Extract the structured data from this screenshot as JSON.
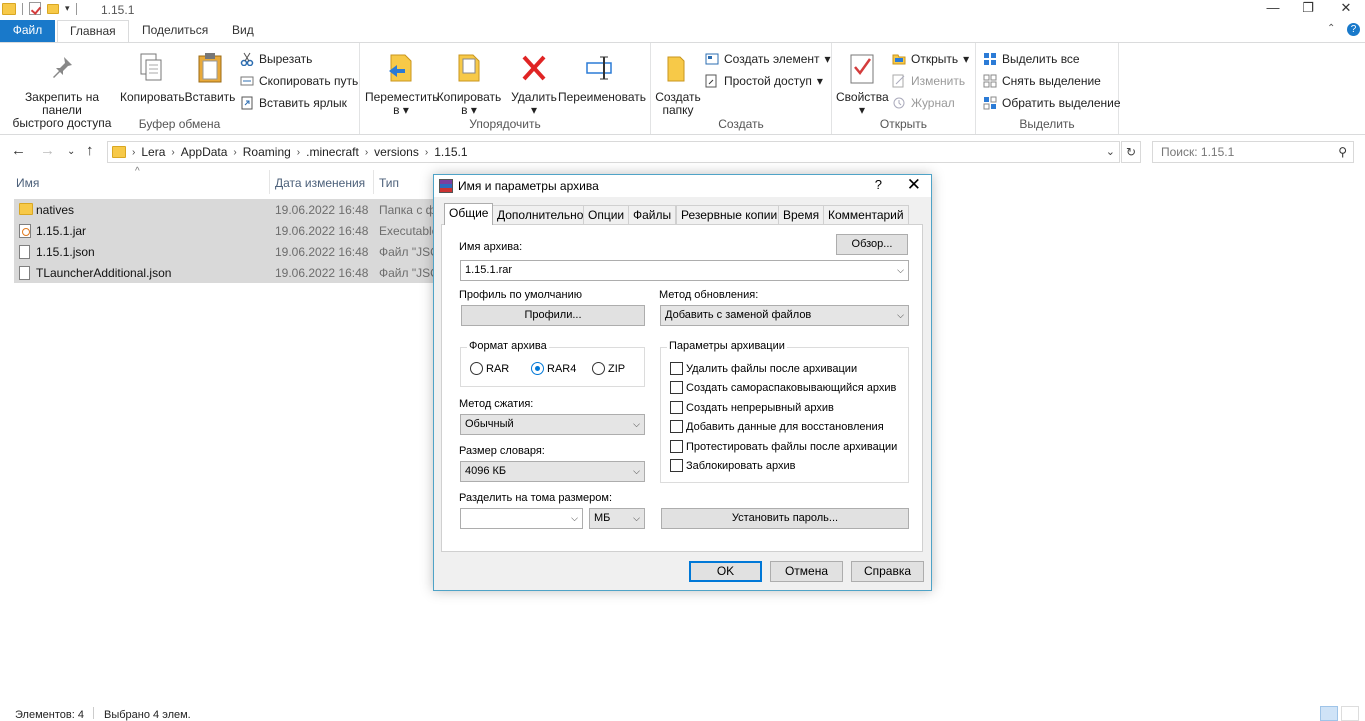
{
  "window": {
    "title": "1.15.1",
    "controls": [
      "—",
      "❐",
      "✕"
    ]
  },
  "ribbon_tabs": {
    "file": "Файл",
    "home": "Главная",
    "share": "Поделиться",
    "view": "Вид"
  },
  "ribbon": {
    "clipboard": {
      "pin": "Закрепить на панели быстрого доступа",
      "pin_l1": "Закрепить на панели",
      "pin_l2": "быстрого доступа",
      "copy": "Копировать",
      "paste": "Вставить",
      "cut": "Вырезать",
      "copy_path": "Скопировать путь",
      "paste_shortcut": "Вставить ярлык",
      "label": "Буфер обмена"
    },
    "organize": {
      "move_l1": "Переместить",
      "move_l2": "в",
      "copy_l1": "Копировать",
      "copy_l2": "в",
      "delete": "Удалить",
      "rename": "Переименовать",
      "label": "Упорядочить"
    },
    "new": {
      "folder_l1": "Создать",
      "folder_l2": "папку",
      "new_item": "Создать элемент",
      "easy_access": "Простой доступ",
      "label": "Создать"
    },
    "open": {
      "properties": "Свойства",
      "open": "Открыть",
      "edit": "Изменить",
      "history": "Журнал",
      "label": "Открыть"
    },
    "select": {
      "select_all": "Выделить все",
      "select_none": "Снять выделение",
      "invert": "Обратить выделение",
      "label": "Выделить"
    }
  },
  "address": {
    "crumbs": [
      "Lera",
      "AppData",
      "Roaming",
      ".minecraft",
      "versions",
      "1.15.1"
    ],
    "search_placeholder": "Поиск: 1.15.1"
  },
  "columns": {
    "name": "Имя",
    "date": "Дата изменения",
    "type": "Тип"
  },
  "files": [
    {
      "name": "natives",
      "date": "19.06.2022 16:48",
      "type": "Папка с фа",
      "icon": "folder-icon"
    },
    {
      "name": "1.15.1.jar",
      "date": "19.06.2022 16:48",
      "type": "Executable",
      "icon": "jar-icon"
    },
    {
      "name": "1.15.1.json",
      "date": "19.06.2022 16:48",
      "type": "Файл \"JSO",
      "icon": "file-icon"
    },
    {
      "name": "TLauncherAdditional.json",
      "date": "19.06.2022 16:48",
      "type": "Файл \"JSO",
      "icon": "file-icon"
    }
  ],
  "status": {
    "items": "Элементов: 4",
    "selected": "Выбрано 4 элем."
  },
  "dialog": {
    "title": "Имя и параметры архива",
    "help": "?",
    "close": "✕",
    "tabs": [
      "Общие",
      "Дополнительно",
      "Опции",
      "Файлы",
      "Резервные копии",
      "Время",
      "Комментарий"
    ],
    "archive_name_label": "Имя архива:",
    "browse": "Обзор...",
    "archive_name": "1.15.1.rar",
    "profile_label": "Профиль по умолчанию",
    "profiles_button": "Профили...",
    "update_method_label": "Метод обновления:",
    "update_method": "Добавить с заменой файлов",
    "format_label": "Формат архива",
    "formats": [
      "RAR",
      "RAR4",
      "ZIP"
    ],
    "selected_format": "RAR4",
    "compression_label": "Метод сжатия:",
    "compression": "Обычный",
    "dict_label": "Размер словаря:",
    "dict": "4096 КБ",
    "split_label": "Разделить на тома размером:",
    "split_value": "",
    "split_unit": "МБ",
    "options_label": "Параметры архивации",
    "options": [
      "Удалить файлы после архивации",
      "Создать самораспаковывающийся архив",
      "Создать непрерывный архив",
      "Добавить данные для восстановления",
      "Протестировать файлы после архивации",
      "Заблокировать архив"
    ],
    "set_password": "Установить пароль...",
    "ok": "OK",
    "cancel": "Отмена",
    "help_button": "Справка"
  }
}
